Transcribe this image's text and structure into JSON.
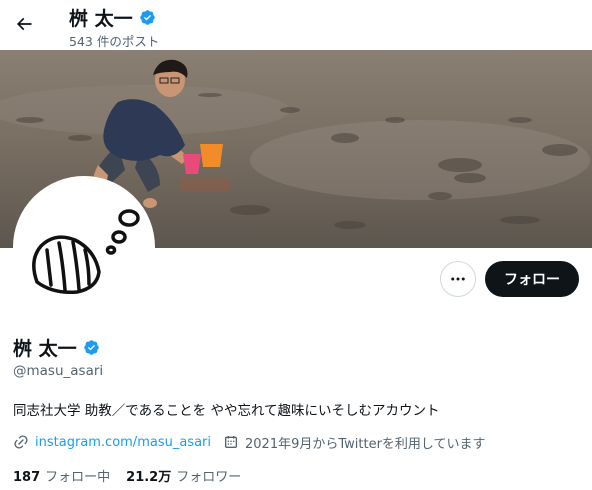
{
  "header": {
    "name": "桝 太一",
    "post_count": "543 件のポスト"
  },
  "profile": {
    "name": "桝 太一",
    "handle": "@masu_asari",
    "bio": "同志社大学 助教／であることを やや忘れて趣味にいそしむアカウント",
    "link": "instagram.com/masu_asari",
    "joined": "2021年9月からTwitterを利用しています"
  },
  "actions": {
    "follow_label": "フォロー"
  },
  "stats": {
    "following_count": "187",
    "following_label": "フォロー中",
    "followers_count": "21.2万",
    "followers_label": "フォロワー"
  },
  "colors": {
    "accent": "#1d9bf0",
    "text": "#0f1419",
    "muted": "#536471",
    "button_dark": "#0f1419"
  }
}
